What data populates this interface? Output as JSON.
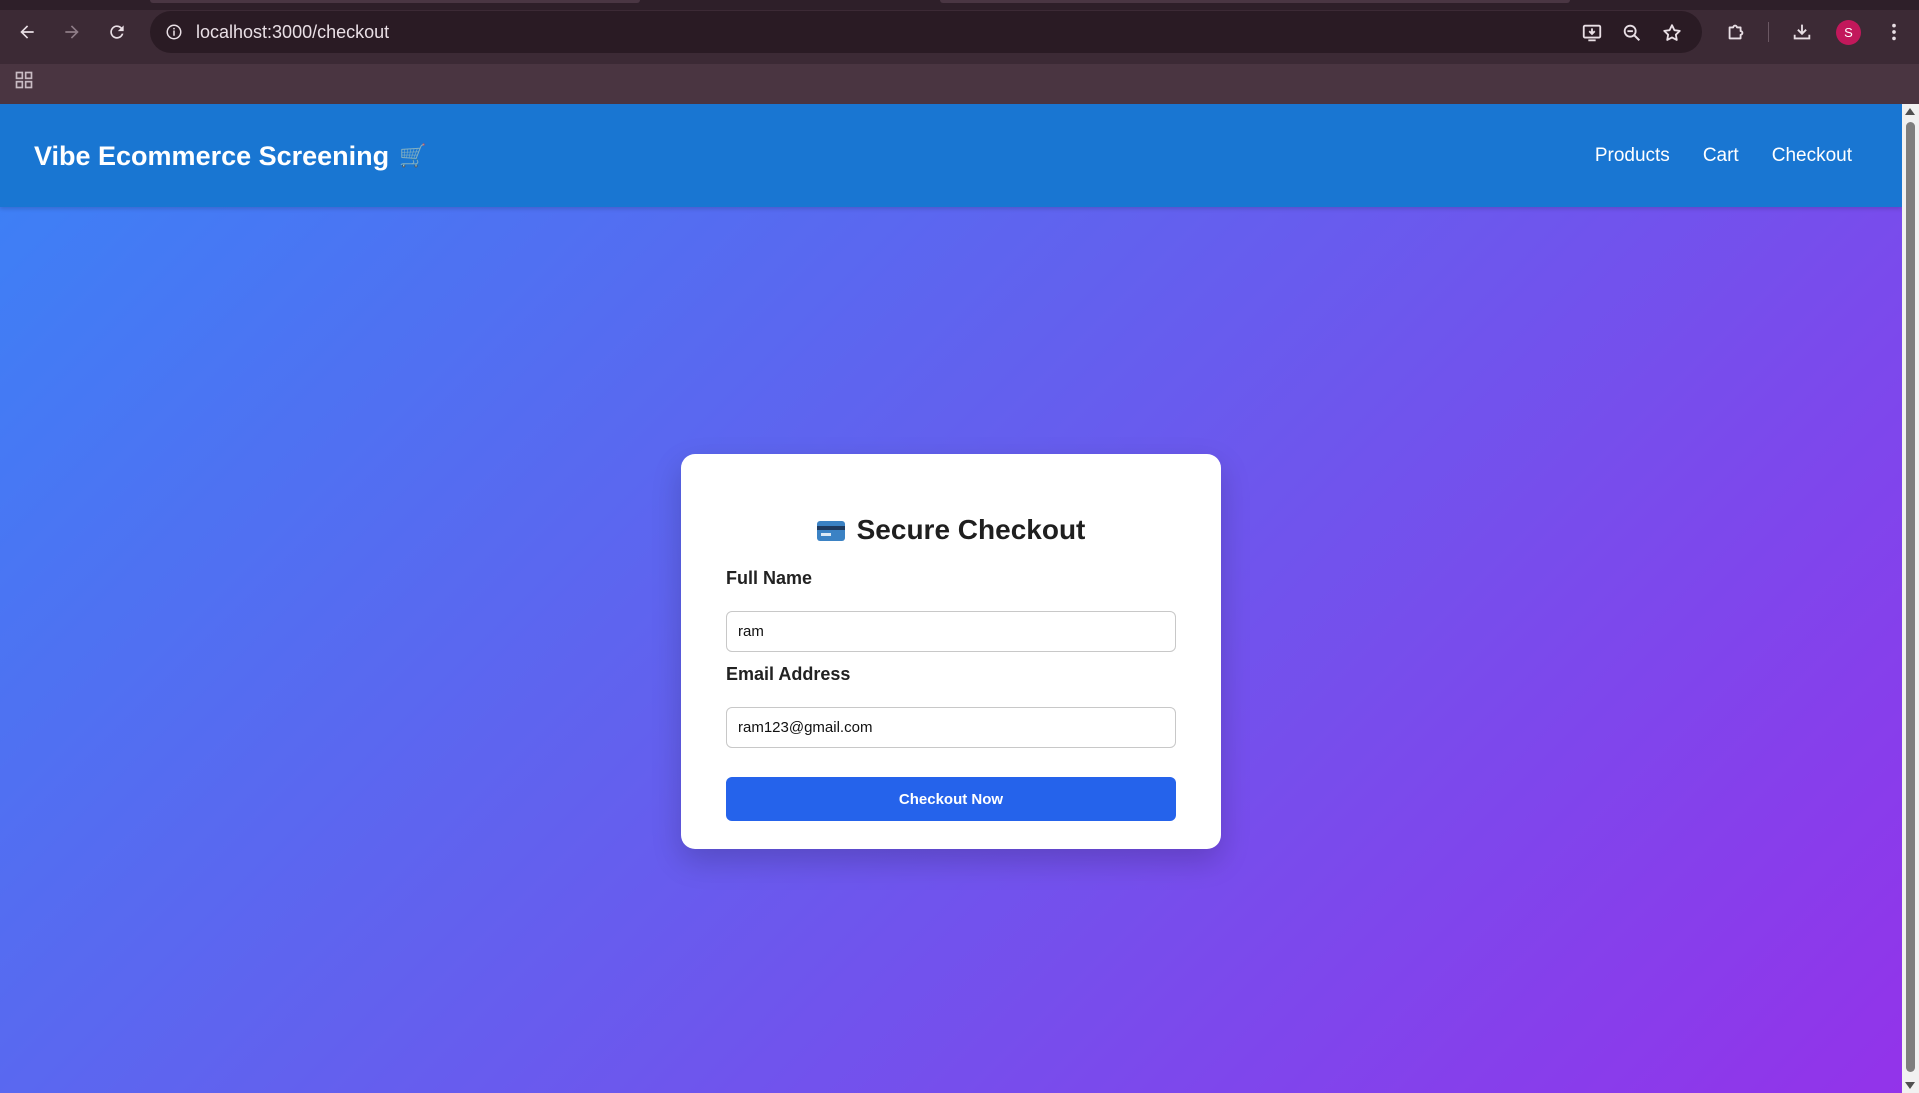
{
  "browser": {
    "url": "localhost:3000/checkout",
    "profile_initial": "S",
    "icons": {
      "back": "arrow-left-icon",
      "forward": "arrow-right-icon",
      "reload": "reload-icon",
      "site_info": "info-icon",
      "install": "install-app-icon",
      "zoom": "zoom-out-icon",
      "bookmark": "star-icon",
      "extensions": "puzzle-icon",
      "downloads": "download-icon",
      "menu": "kebab-menu-icon",
      "apps": "apps-grid-icon"
    }
  },
  "header": {
    "brand": "Vibe Ecommerce Screening",
    "brand_icon": "🛒",
    "nav": [
      "Products",
      "Cart",
      "Checkout"
    ]
  },
  "checkout": {
    "title": "Secure Checkout",
    "title_icon": "credit-card-icon",
    "full_name_label": "Full Name",
    "full_name_value": "ram",
    "email_label": "Email Address",
    "email_value": "ram123@gmail.com",
    "submit_label": "Checkout Now"
  },
  "colors": {
    "header": "#1976d2",
    "gradient_start": "#3b82f6",
    "gradient_end": "#9333ea",
    "button": "#2563eb"
  }
}
